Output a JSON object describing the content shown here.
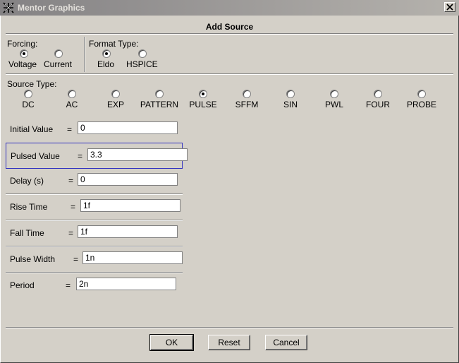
{
  "window": {
    "title": "Mentor Graphics"
  },
  "dialog": {
    "title": "Add Source"
  },
  "forcing": {
    "label": "Forcing:",
    "options": [
      {
        "label": "Voltage",
        "checked": true
      },
      {
        "label": "Current",
        "checked": false
      }
    ]
  },
  "format_type": {
    "label": "Format Type:",
    "options": [
      {
        "label": "Eldo",
        "checked": true
      },
      {
        "label": "HSPICE",
        "checked": false
      }
    ]
  },
  "source_type": {
    "label": "Source Type:",
    "options": [
      {
        "label": "DC",
        "checked": false
      },
      {
        "label": "AC",
        "checked": false
      },
      {
        "label": "EXP",
        "checked": false
      },
      {
        "label": "PATTERN",
        "checked": false
      },
      {
        "label": "PULSE",
        "checked": true
      },
      {
        "label": "SFFM",
        "checked": false
      },
      {
        "label": "SIN",
        "checked": false
      },
      {
        "label": "PWL",
        "checked": false
      },
      {
        "label": "FOUR",
        "checked": false
      },
      {
        "label": "PROBE",
        "checked": false
      }
    ]
  },
  "fields": [
    {
      "label": "Initial Value",
      "eq": "=",
      "value": "0"
    },
    {
      "label": "Pulsed Value",
      "eq": "=",
      "value": "3.3",
      "focused": true
    },
    {
      "label": "Delay (s)",
      "eq": "=",
      "value": "0"
    },
    {
      "label": "Rise Time",
      "eq": "=",
      "value": "1f"
    },
    {
      "label": "Fall Time",
      "eq": "=",
      "value": "1f"
    },
    {
      "label": "Pulse Width",
      "eq": "=",
      "value": "1n"
    },
    {
      "label": "Period",
      "eq": "=",
      "value": "2n"
    }
  ],
  "buttons": {
    "ok": "OK",
    "reset": "Reset",
    "cancel": "Cancel"
  }
}
